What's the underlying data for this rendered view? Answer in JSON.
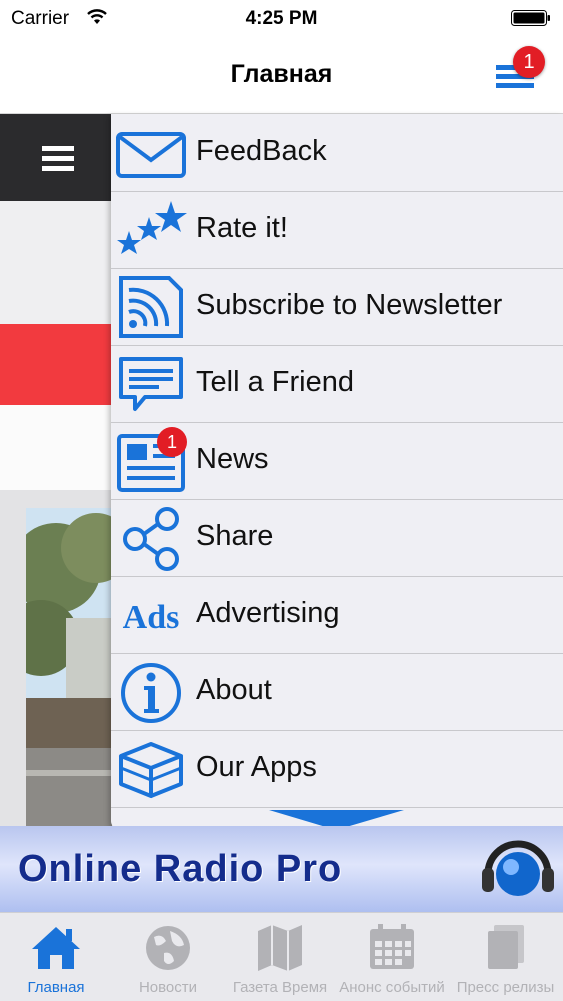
{
  "status_bar": {
    "carrier": "Carrier",
    "time": "4:25 PM"
  },
  "navbar": {
    "title": "Главная",
    "menu_badge": "1"
  },
  "menu": {
    "items": [
      {
        "label": "FeedBack",
        "icon": "envelope-icon"
      },
      {
        "label": "Rate it!",
        "icon": "stars-icon"
      },
      {
        "label": "Subscribe to Newsletter",
        "icon": "rss-document-icon"
      },
      {
        "label": "Tell a Friend",
        "icon": "chat-bubble-icon"
      },
      {
        "label": "News",
        "icon": "newspaper-icon",
        "badge": "1"
      },
      {
        "label": "Share",
        "icon": "share-icon"
      },
      {
        "label": "Advertising",
        "icon": "ads-icon",
        "icon_text": "Ads"
      },
      {
        "label": "About",
        "icon": "info-icon"
      },
      {
        "label": "Our Apps",
        "icon": "box-icon"
      }
    ]
  },
  "banner": {
    "text": "Online Radio Pro"
  },
  "tabbar": {
    "tabs": [
      {
        "label": "Главная",
        "icon": "home-icon",
        "active": true
      },
      {
        "label": "Новости",
        "icon": "globe-icon"
      },
      {
        "label": "Газета Время",
        "icon": "map-icon"
      },
      {
        "label": "Анонс событий",
        "icon": "calendar-icon"
      },
      {
        "label": "Пресс релизы",
        "icon": "document-icon"
      }
    ]
  },
  "colors": {
    "accent_blue": "#1a73d9",
    "badge_red": "#e21d25",
    "tab_inactive": "#b2b2b6",
    "banner_text": "#142c8c"
  }
}
